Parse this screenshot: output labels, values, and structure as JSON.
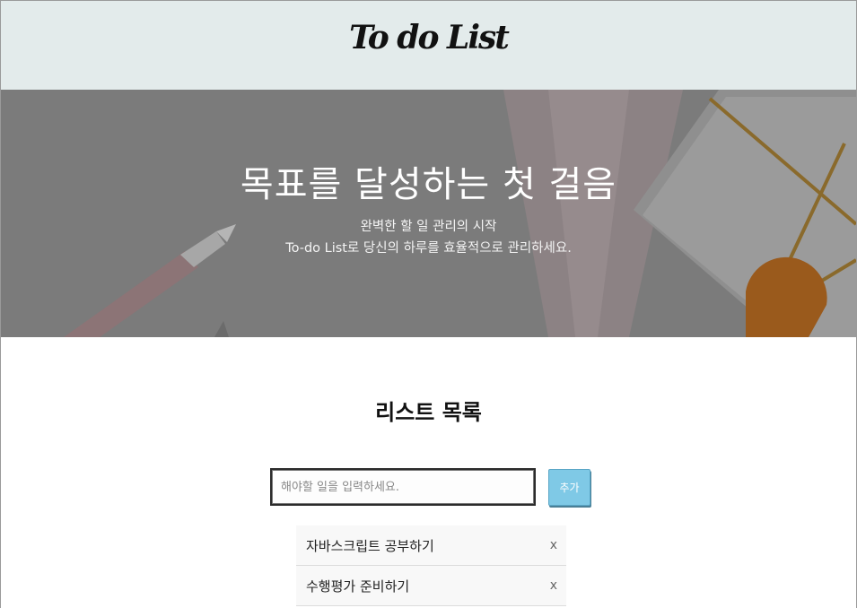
{
  "header": {
    "logo": "To do List"
  },
  "hero": {
    "title": "목표를 달성하는 첫 걸음",
    "subtitle_line1": "완벽한 할 일 관리의 시작",
    "subtitle_line2": "To-do List로 당신의 하루를 효율적으로 관리하세요."
  },
  "main": {
    "section_title": "리스트 목록",
    "input": {
      "placeholder": "해야할 일을 입력하세요.",
      "value": ""
    },
    "add_label": "추가",
    "items": [
      {
        "text": "자바스크립트 공부하기",
        "delete_label": "x"
      },
      {
        "text": "수행평가 준비하기",
        "delete_label": "x"
      }
    ]
  },
  "colors": {
    "header_bg": "#e3ebeb",
    "hero_overlay": "#7a7a7a",
    "add_button": "#7fc9e6"
  }
}
